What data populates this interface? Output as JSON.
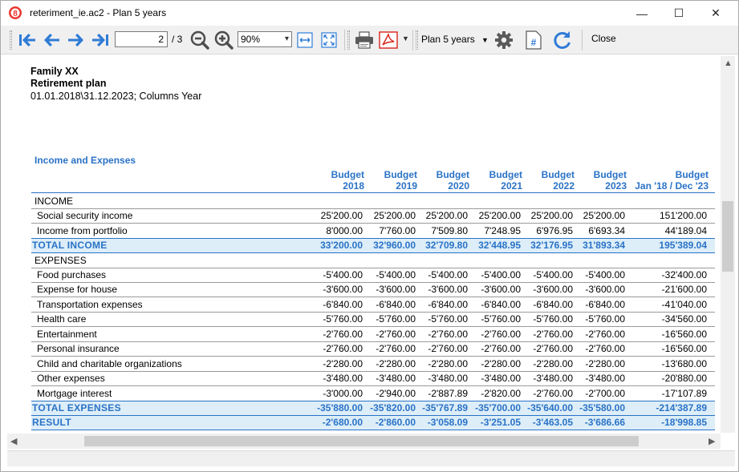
{
  "window": {
    "title": "reteriment_ie.ac2 - Plan 5 years",
    "minimize": "—",
    "maximize": "☐",
    "close": "✕"
  },
  "toolbar": {
    "page_value": "2",
    "page_total": "/ 3",
    "zoom_value": "90%",
    "plan_menu": "Plan 5 years",
    "close_label": "Close",
    "icons": [
      "first-page-icon",
      "previous-page-icon",
      "next-page-icon",
      "last-page-icon",
      "zoom-out-icon",
      "zoom-in-icon",
      "fit-width-icon",
      "fit-page-icon",
      "print-icon",
      "pdf-icon",
      "settings-icon",
      "page-number-icon",
      "refresh-icon"
    ]
  },
  "report": {
    "header_line1": "Family XX",
    "header_line2": "Retirement plan",
    "header_line3": "01.01.2018\\31.12.2023; Columns Year",
    "section_title": "Income and Expenses",
    "columns": [
      {
        "line1": "Budget",
        "line2": "2018"
      },
      {
        "line1": "Budget",
        "line2": "2019"
      },
      {
        "line1": "Budget",
        "line2": "2020"
      },
      {
        "line1": "Budget",
        "line2": "2021"
      },
      {
        "line1": "Budget",
        "line2": "2022"
      },
      {
        "line1": "Budget",
        "line2": "2023"
      },
      {
        "line1": "Budget",
        "line2": "Jan '18 / Dec '23"
      }
    ],
    "rows": [
      {
        "type": "group",
        "label": "INCOME",
        "values": []
      },
      {
        "type": "item",
        "label": "Social security income",
        "values": [
          "25'200.00",
          "25'200.00",
          "25'200.00",
          "25'200.00",
          "25'200.00",
          "25'200.00",
          "151'200.00"
        ]
      },
      {
        "type": "item",
        "label": "Income from portfolio",
        "values": [
          "8'000.00",
          "7'760.00",
          "7'509.80",
          "7'248.95",
          "6'976.95",
          "6'693.34",
          "44'189.04"
        ]
      },
      {
        "type": "total",
        "label": "TOTAL INCOME",
        "values": [
          "33'200.00",
          "32'960.00",
          "32'709.80",
          "32'448.95",
          "32'176.95",
          "31'893.34",
          "195'389.04"
        ]
      },
      {
        "type": "group",
        "label": "EXPENSES",
        "values": []
      },
      {
        "type": "item",
        "label": "Food purchases",
        "values": [
          "-5'400.00",
          "-5'400.00",
          "-5'400.00",
          "-5'400.00",
          "-5'400.00",
          "-5'400.00",
          "-32'400.00"
        ]
      },
      {
        "type": "item",
        "label": "Expense for house",
        "values": [
          "-3'600.00",
          "-3'600.00",
          "-3'600.00",
          "-3'600.00",
          "-3'600.00",
          "-3'600.00",
          "-21'600.00"
        ]
      },
      {
        "type": "item",
        "label": "Transportation expenses",
        "values": [
          "-6'840.00",
          "-6'840.00",
          "-6'840.00",
          "-6'840.00",
          "-6'840.00",
          "-6'840.00",
          "-41'040.00"
        ]
      },
      {
        "type": "item",
        "label": "Health care",
        "values": [
          "-5'760.00",
          "-5'760.00",
          "-5'760.00",
          "-5'760.00",
          "-5'760.00",
          "-5'760.00",
          "-34'560.00"
        ]
      },
      {
        "type": "item",
        "label": "Entertainment",
        "values": [
          "-2'760.00",
          "-2'760.00",
          "-2'760.00",
          "-2'760.00",
          "-2'760.00",
          "-2'760.00",
          "-16'560.00"
        ]
      },
      {
        "type": "item",
        "label": "Personal insurance",
        "values": [
          "-2'760.00",
          "-2'760.00",
          "-2'760.00",
          "-2'760.00",
          "-2'760.00",
          "-2'760.00",
          "-16'560.00"
        ]
      },
      {
        "type": "item",
        "label": "Child and charitable organizations",
        "values": [
          "-2'280.00",
          "-2'280.00",
          "-2'280.00",
          "-2'280.00",
          "-2'280.00",
          "-2'280.00",
          "-13'680.00"
        ]
      },
      {
        "type": "item",
        "label": "Other expenses",
        "values": [
          "-3'480.00",
          "-3'480.00",
          "-3'480.00",
          "-3'480.00",
          "-3'480.00",
          "-3'480.00",
          "-20'880.00"
        ]
      },
      {
        "type": "item",
        "label": "Mortgage interest",
        "values": [
          "-3'000.00",
          "-2'940.00",
          "-2'887.89",
          "-2'820.00",
          "-2'760.00",
          "-2'700.00",
          "-17'107.89"
        ]
      },
      {
        "type": "total",
        "label": "TOTAL EXPENSES",
        "values": [
          "-35'880.00",
          "-35'820.00",
          "-35'767.89",
          "-35'700.00",
          "-35'640.00",
          "-35'580.00",
          "-214'387.89"
        ]
      },
      {
        "type": "total",
        "label": "RESULT",
        "values": [
          "-2'680.00",
          "-2'860.00",
          "-3'058.09",
          "-3'251.05",
          "-3'463.05",
          "-3'686.66",
          "-18'998.85"
        ]
      }
    ]
  },
  "colors": {
    "accent": "#2a72c6",
    "total_band": "#ddeef9",
    "toolbar_bg": "#f0f0f0"
  }
}
